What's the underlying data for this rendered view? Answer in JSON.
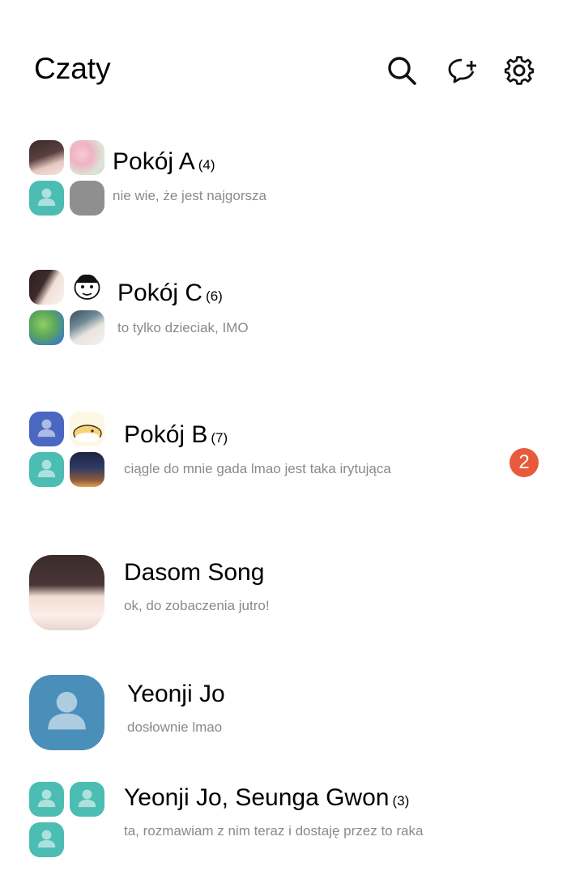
{
  "header": {
    "title": "Czaty"
  },
  "chats": [
    {
      "name": "Pokój A",
      "count": "(4)",
      "message": "nie wie, że jest najgorsza"
    },
    {
      "name": "Pokój C",
      "count": "(6)",
      "message": "to tylko dzieciak, IMO"
    },
    {
      "name": "Pokój B",
      "count": "(7)",
      "message": "ciągle do mnie gada lmao jest taka irytująca",
      "unread": "2"
    },
    {
      "name": "Dasom Song",
      "count": "",
      "message": "ok, do zobaczenia jutro!"
    },
    {
      "name": "Yeonji Jo",
      "count": "",
      "message": "dosłownie lmao"
    },
    {
      "name": "Yeonji Jo, Seunga Gwon",
      "count": "(3)",
      "message": "ta, rozmawiam z nim teraz i dostaję przez to raka"
    }
  ],
  "colors": {
    "teal": "#4bbdb3",
    "blue": "#4a67c1",
    "steel": "#4a8fba",
    "badge": "#e75a3c"
  },
  "icons": [
    "search-icon",
    "new-chat-icon",
    "settings-gear-icon",
    "person-icon"
  ]
}
